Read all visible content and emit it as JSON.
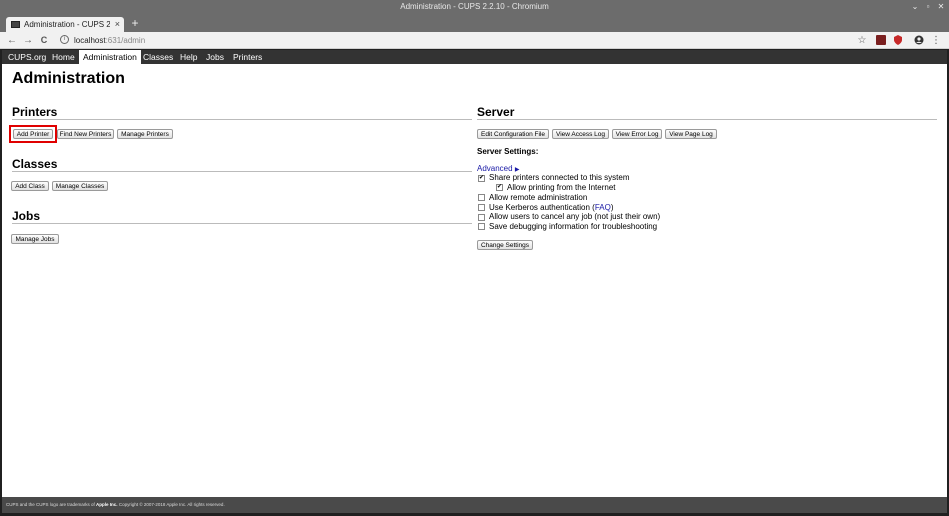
{
  "window": {
    "title": "Administration - CUPS 2.2.10 - Chromium",
    "controls": {
      "minimize": "⌄",
      "maximize": "▫",
      "close": "✕"
    }
  },
  "tabs": [
    {
      "title": "Administration - CUPS 2",
      "close": "×"
    }
  ],
  "newtab": "+",
  "toolbar": {
    "back": "←",
    "forward": "→",
    "reload": "C",
    "url_host": "localhost",
    "url_path": ":631/admin",
    "star": "☆"
  },
  "cups_nav": [
    "CUPS.org",
    "Home",
    "Administration",
    "Classes",
    "Help",
    "Jobs",
    "Printers"
  ],
  "cups_nav_active": "Administration",
  "page_title": "Administration",
  "printers": {
    "heading": "Printers",
    "buttons": [
      "Add Printer",
      "Find New Printers",
      "Manage Printers"
    ]
  },
  "classes": {
    "heading": "Classes",
    "buttons": [
      "Add Class",
      "Manage Classes"
    ]
  },
  "jobs": {
    "heading": "Jobs",
    "buttons": [
      "Manage Jobs"
    ]
  },
  "server": {
    "heading": "Server",
    "buttons": [
      "Edit Configuration File",
      "View Access Log",
      "View Error Log",
      "View Page Log"
    ],
    "settings_label": "Server Settings:",
    "advanced_link": "Advanced",
    "advanced_arrow": "▶",
    "options": [
      {
        "label": "Share printers connected to this system",
        "checked": true
      },
      {
        "label": "Allow printing from the Internet",
        "checked": true
      },
      {
        "label": "Allow remote administration",
        "checked": false
      },
      {
        "label_pre": "Use Kerberos authentication (",
        "link": "FAQ",
        "label_post": ")",
        "checked": false
      },
      {
        "label": "Allow users to cancel any job (not just their own)",
        "checked": false
      },
      {
        "label": "Save debugging information for troubleshooting",
        "checked": false
      }
    ],
    "change_button": "Change Settings"
  },
  "footer": {
    "pre": "CUPS and the CUPS logo are trademarks of ",
    "brand": "Apple Inc.",
    "post": " Copyright © 2007-2018 Apple Inc. All rights reserved."
  },
  "colors": {
    "highlight": "#e00000",
    "nav_bg": "#333333",
    "link": "#1a1aa6"
  }
}
